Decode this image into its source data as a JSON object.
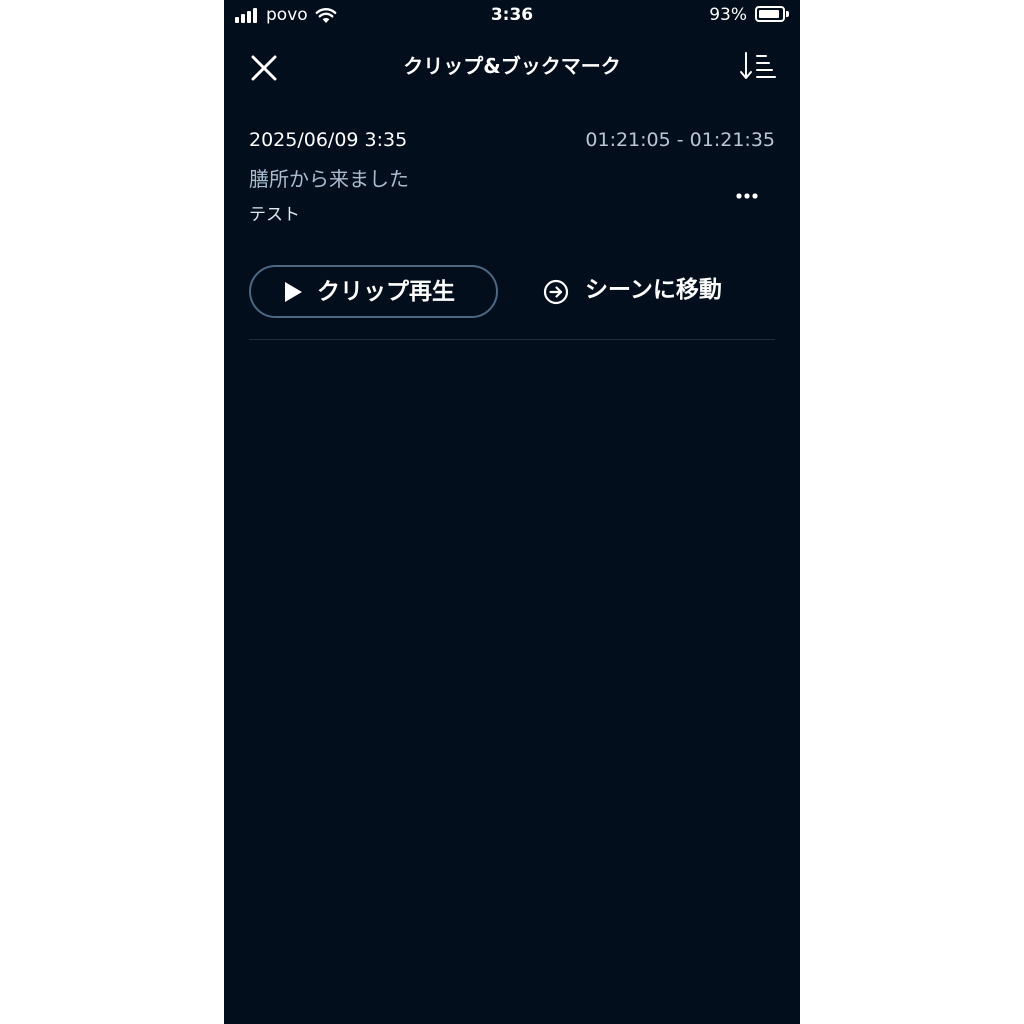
{
  "status_bar": {
    "carrier": "povo",
    "time": "3:36",
    "battery_percent": "93%",
    "battery_level": 0.93,
    "signal_bars": 4,
    "icons": [
      "signal-icon",
      "wifi-icon",
      "battery-icon"
    ]
  },
  "header": {
    "title": "クリップ&ブックマーク",
    "close_icon": "close-icon",
    "sort_icon": "sort-icon"
  },
  "clips": [
    {
      "date": "2025/06/09 3:35",
      "range": "01:21:05 - 01:21:35",
      "title": "膳所から来ました",
      "note": "テスト",
      "play_label": "クリップ再生",
      "scene_label": "シーンに移動"
    }
  ],
  "colors": {
    "background": "#020e1b",
    "divider": "#1d2d3e",
    "button_border": "#4d6883",
    "muted_text": "#a9bccf"
  }
}
